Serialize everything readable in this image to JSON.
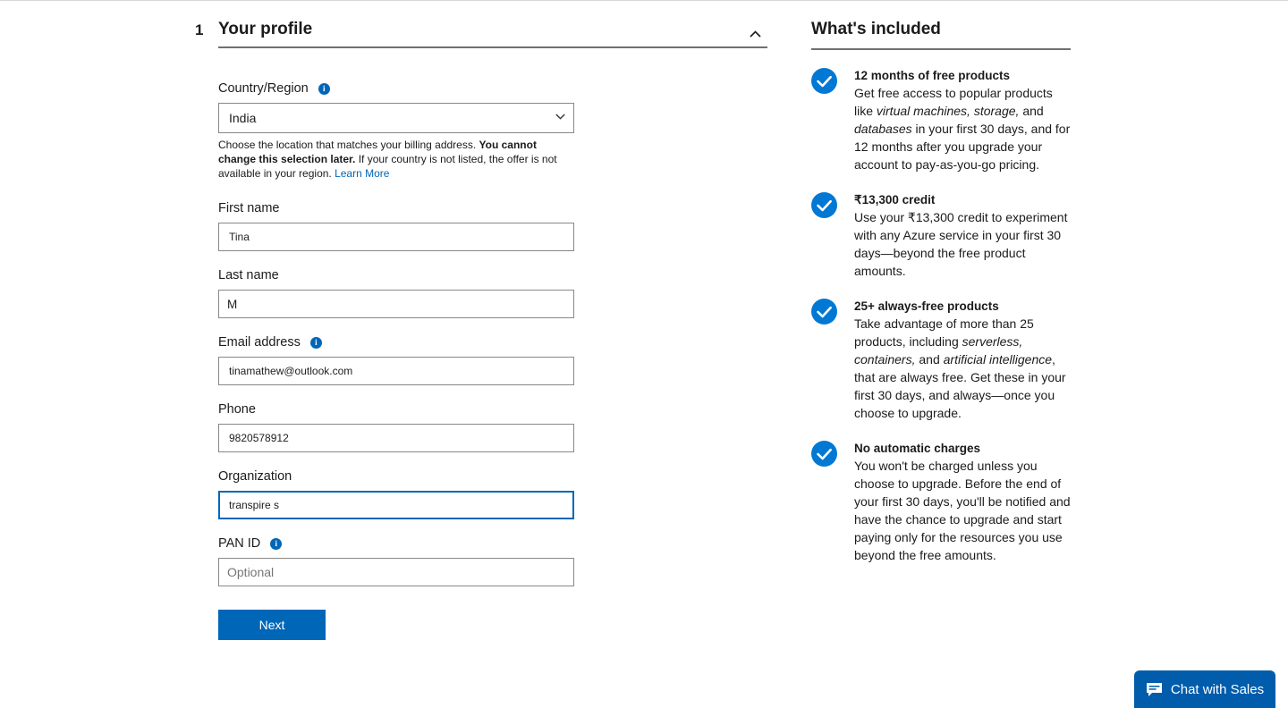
{
  "colors": {
    "accent": "#0067b8",
    "chat_bg": "#015cab",
    "rule": "#707070",
    "field_border": "#8a8886",
    "focus_border": "#0067b8"
  },
  "form": {
    "step_number": "1",
    "title": "Your profile",
    "collapse_icon": "chevron-up-icon",
    "country": {
      "label": "Country/Region",
      "info_icon": "info-icon",
      "value": "India",
      "options": [
        "India"
      ],
      "helper_prefix": "Choose the location that matches your billing address. ",
      "helper_bold": "You cannot change this selection later.",
      "helper_suffix": " If your country is not listed, the offer is not available in your region. ",
      "helper_link": "Learn More"
    },
    "first_name": {
      "label": "First name",
      "value": "Tina",
      "placeholder": ""
    },
    "last_name": {
      "label": "Last name",
      "value": "M",
      "placeholder": ""
    },
    "email": {
      "label": "Email address",
      "info_icon": "info-icon",
      "value": "tinamathew@outlook.com",
      "placeholder": ""
    },
    "phone": {
      "label": "Phone",
      "value": "9820578912",
      "placeholder": ""
    },
    "organization": {
      "label": "Organization",
      "value": "transpire s",
      "placeholder": "",
      "focused": true
    },
    "pan_id": {
      "label": "PAN ID",
      "info_icon": "info-icon",
      "value": "",
      "placeholder": "Optional"
    },
    "next_label": "Next"
  },
  "rail": {
    "title": "What's included",
    "benefits": [
      {
        "icon": "check-circle-icon",
        "title": "12 months of free products",
        "text_parts": [
          {
            "t": "Get free access to popular products like ",
            "i": false
          },
          {
            "t": "virtual machines, storage,",
            "i": true
          },
          {
            "t": " and ",
            "i": false
          },
          {
            "t": "databases",
            "i": true
          },
          {
            "t": " in your first 30 days, and for 12 months after you upgrade your account to pay-as-you-go pricing.",
            "i": false
          }
        ]
      },
      {
        "icon": "check-circle-icon",
        "title": "₹13,300 credit",
        "text_parts": [
          {
            "t": "Use your ₹13,300 credit to experiment with any Azure service in your first 30 days—beyond the free product amounts.",
            "i": false
          }
        ]
      },
      {
        "icon": "check-circle-icon",
        "title": "25+ always-free products",
        "text_parts": [
          {
            "t": "Take advantage of more than 25 products, including ",
            "i": false
          },
          {
            "t": "serverless, containers,",
            "i": true
          },
          {
            "t": " and ",
            "i": false
          },
          {
            "t": "artificial intelligence",
            "i": true
          },
          {
            "t": ", that are always free. Get these in your first 30 days, and always—once you choose to upgrade.",
            "i": false
          }
        ]
      },
      {
        "icon": "check-circle-icon",
        "title": "No automatic charges",
        "text_parts": [
          {
            "t": "You won't be charged unless you choose to upgrade. Before the end of your first 30 days, you'll be notified and have the chance to upgrade and start paying only for the resources you use beyond the free amounts.",
            "i": false
          }
        ]
      }
    ]
  },
  "chat": {
    "icon": "chat-bubble-icon",
    "label": "Chat with Sales"
  }
}
